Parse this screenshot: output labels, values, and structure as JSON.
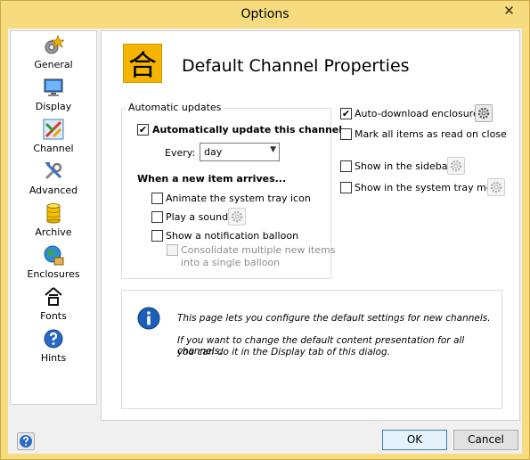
{
  "window": {
    "title": "Options",
    "close_label": "✕"
  },
  "sidebar": {
    "items": [
      {
        "label": "General",
        "icon": "gear-star-icon"
      },
      {
        "label": "Display",
        "icon": "monitor-icon"
      },
      {
        "label": "Channel",
        "icon": "channel-icon",
        "selected": true
      },
      {
        "label": "Advanced",
        "icon": "tools-icon"
      },
      {
        "label": "Archive",
        "icon": "database-icon"
      },
      {
        "label": "Enclosures",
        "icon": "globe-icon"
      },
      {
        "label": "Fonts",
        "icon": "font-glyph-icon"
      },
      {
        "label": "Hints",
        "icon": "question-icon"
      }
    ]
  },
  "header": {
    "title": "Default Channel Properties",
    "icon_glyph": "合"
  },
  "auto_updates": {
    "legend": "Automatic updates",
    "auto_update_label": "Automatically update this channel",
    "auto_update_checked": true,
    "every_label": "Every:",
    "every_value": "day",
    "new_item_heading": "When a new item arrives...",
    "animate_label": "Animate the system tray icon",
    "play_sound_label": "Play a sound",
    "balloon_label": "Show a notification balloon",
    "consolidate_label_1": "Consolidate multiple new items",
    "consolidate_label_2": "into a single balloon"
  },
  "right_options": {
    "auto_download_label": "Auto-download enclosures",
    "auto_download_checked": true,
    "mark_read_label": "Mark all items as read on close",
    "show_sidebar_label": "Show in the sidebar",
    "show_tray_menu_label": "Show in the system tray menu"
  },
  "info": {
    "line1": "This page lets you configure the default settings for new channels.",
    "line2": "If you want to change the default content presentation for all channels,",
    "line3": "you can do it in the Display tab of this dialog."
  },
  "buttons": {
    "ok": "OK",
    "cancel": "Cancel"
  },
  "colors": {
    "title_bar": "#f6dc7e",
    "accent": "#3c7fb1"
  }
}
